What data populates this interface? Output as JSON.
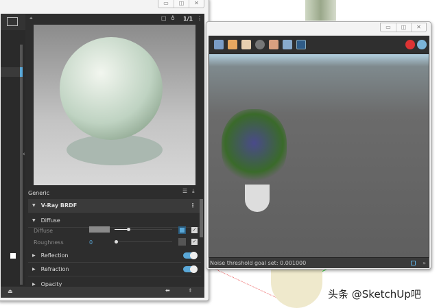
{
  "material_editor": {
    "preview_toolbar": {
      "ratio_label": "1/1"
    },
    "panel_title": "Generic",
    "material_type": "V-Ray BRDF",
    "sections": {
      "diffuse": {
        "label": "Diffuse",
        "params": [
          {
            "label": "Diffuse",
            "value": ""
          },
          {
            "label": "Roughness",
            "value": "0"
          }
        ]
      },
      "reflection": {
        "label": "Reflection",
        "enabled": true
      },
      "refraction": {
        "label": "Refraction",
        "enabled": true
      },
      "opacity": {
        "label": "Opacity"
      }
    },
    "window_buttons": {
      "minimize": "▭",
      "restore": "◫",
      "close": "✕"
    }
  },
  "frame_buffer": {
    "status_text": "Noise threshold goal set: 0.001000",
    "window_buttons": {
      "minimize": "▭",
      "restore": "◫",
      "close": "✕"
    }
  },
  "watermark": "头条 @SketchUp吧",
  "colors": {
    "accent": "#5aa8d8",
    "panel": "#2d2d2d",
    "status": "#3a3a3a"
  }
}
